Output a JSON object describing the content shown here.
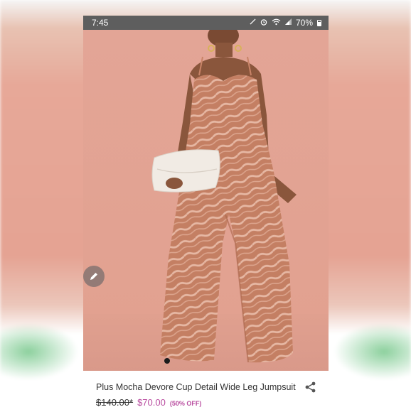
{
  "status_bar": {
    "time": "7:45",
    "battery": "70%",
    "icons": [
      "mute-icon",
      "alarm-icon",
      "wifi-icon",
      "signal-icon",
      "battery-icon"
    ]
  },
  "listing": {
    "photo_description_icon": "edit-pencil-icon",
    "title": "Plus Mocha Devore Cup Detail Wide Leg Jumpsuit",
    "original_price": "$140.00*",
    "sale_price": "$70.00",
    "discount": "(50% OFF)",
    "share_icon": "share-icon"
  },
  "colors": {
    "background": "#e3a596",
    "jumpsuit": "#c98468",
    "sale_accent": "#b94da0"
  }
}
